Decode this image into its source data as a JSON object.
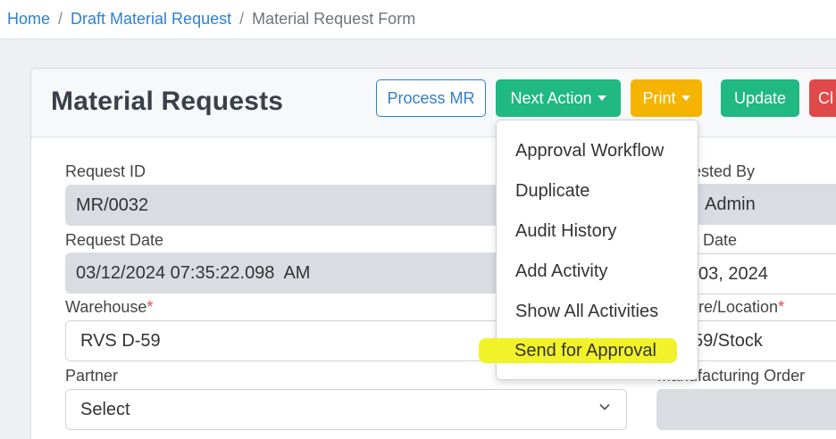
{
  "breadcrumb": {
    "home": "Home",
    "separator": "/",
    "draft": "Draft Material Request",
    "current": "Material Request Form"
  },
  "header": {
    "title": "Material Requests",
    "process_mr": "Process MR",
    "next_action": "Next Action",
    "print": "Print",
    "update": "Update",
    "close_partial": "Cl"
  },
  "next_action_menu": {
    "items": [
      "Approval Workflow",
      "Duplicate",
      "Audit History",
      "Add Activity",
      "Show All Activities",
      "Send for Approval"
    ],
    "highlight_color": "#f2f22a"
  },
  "form": {
    "request_id": {
      "label": "Request ID",
      "value": "MR/0032"
    },
    "request_date": {
      "label": "Request Date",
      "value": "03/12/2024 07:35:22.098  AM"
    },
    "warehouse": {
      "label": "Warehouse",
      "required_mark": "*",
      "value": "RVS D-59"
    },
    "partner": {
      "label": "Partner",
      "value": "Select"
    },
    "requested_by": {
      "label_partial": "ested By",
      "value_partial": "Admin"
    },
    "target_date": {
      "label_partial": "t Date",
      "value_partial": "03, 2024"
    },
    "store_location": {
      "label_partial": "ore/Location",
      "required_mark": "*",
      "value_partial": "59/Stock"
    },
    "manufacturing_order": {
      "label": "Manufacturing Order",
      "value": ""
    }
  },
  "colors": {
    "link": "#2f7fd1",
    "success": "#20b883",
    "warning": "#f5b400",
    "danger": "#e04949"
  }
}
